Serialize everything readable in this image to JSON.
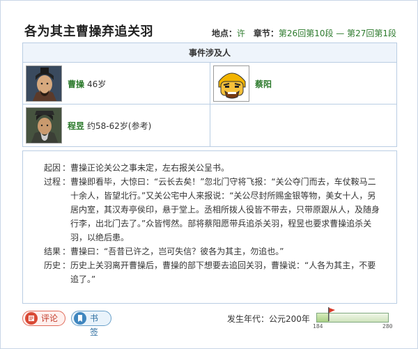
{
  "header": {
    "title": "各为其主曹操弃追关羽",
    "location_label": "地点：",
    "location_value": "许",
    "chapter_label": "章节：",
    "chapter_value": "第26回第10段 — 第27回第1段"
  },
  "people": {
    "heading": "事件涉及人",
    "persons": [
      {
        "name": "曹操",
        "age": "46岁",
        "avatar_icon": "cao-cao-portrait"
      },
      {
        "name": "蔡阳",
        "age": "",
        "avatar_icon": "cai-yang-portrait"
      },
      {
        "name": "程昱",
        "age": "约58-62岁(参考)",
        "avatar_icon": "cheng-yu-portrait"
      }
    ]
  },
  "story": [
    {
      "key": "起因",
      "colon": "：",
      "text": "曹操正论关公之事未定，左右报关公呈书。"
    },
    {
      "key": "过程",
      "colon": "：",
      "text": "曹操即看毕，大惊曰：“云长去矣！”忽北门守将飞报：“关公夺门而去，车仗鞍马二十余人，皆望北行。”又关公宅中人来报说：“关公尽封所赐金银等物，美女十人，另居内室，其汉寿亭侯印，悬于堂上。丞相所拨人役皆不带去，只带原跟从人，及随身行李，出北门去了。”众皆愕然。部将蔡阳愿带兵追杀关羽，程昱也要求曹操追杀关羽，以绝后患。"
    },
    {
      "key": "结果",
      "colon": "：",
      "text": "曹操曰：“吾昔已许之，岂可失信？彼各为其主，勿追也。”"
    },
    {
      "key": "历史",
      "colon": "：",
      "text": "历史上关羽离开曹操后，曹操的部下想要去追回关羽，曹操说：“人各为其主，不要追了。”"
    }
  ],
  "actions": {
    "comment_label": "评论",
    "bookmark_label": "书签"
  },
  "timeline": {
    "era_label": "发生年代：公元200年",
    "min_label": "184",
    "max_label": "280",
    "min": 184,
    "max": 280,
    "value": 200
  },
  "colors": {
    "accent_green": "#2c7a2c",
    "border_blue": "#b9cde3",
    "comment_red": "#d94a36",
    "bookmark_blue": "#3f86bf",
    "flag_red": "#d83a2a"
  }
}
